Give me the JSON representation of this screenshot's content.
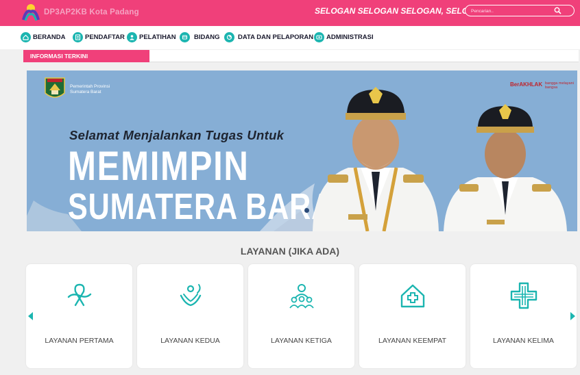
{
  "header": {
    "logo_text": "DP3AP2KB Kota Padang",
    "slogan": "SELOGAN SELOGAN SELOGAN, SELOGAN",
    "search_placeholder": "Pencarian..",
    "colors": {
      "primary": "#f0407a",
      "accent": "#1bb5b0"
    }
  },
  "nav": {
    "items": [
      {
        "label": "BERANDA",
        "icon": "home-icon"
      },
      {
        "label": "PENDAFTAR",
        "icon": "register-icon"
      },
      {
        "label": "PELATIHAN",
        "icon": "training-icon"
      },
      {
        "label": "BIDANG",
        "icon": "field-icon"
      },
      {
        "label": "DATA DAN PELAPORAN",
        "icon": "data-icon"
      },
      {
        "label": "ADMINISTRASI",
        "icon": "admin-icon"
      }
    ]
  },
  "info": {
    "label": "INFORMASI TERKINI"
  },
  "banner": {
    "org_line1": "Pemerintah Provinsi",
    "org_line2": "Sumatera Barat",
    "berakhlak": "BerAKHLAK",
    "bangga": "bangga melayani bangsa",
    "subtitle": "Selamat Menjalankan Tugas Untuk",
    "title_line1": "MEMIMPIN",
    "title_line2": "SUMATERA BARAT"
  },
  "services": {
    "title": "LAYANAN (JIKA ADA)",
    "items": [
      {
        "label": "LAYANAN PERTAMA",
        "icon": "ribbon-icon"
      },
      {
        "label": "LAYANAN KEDUA",
        "icon": "hands-icon"
      },
      {
        "label": "LAYANAN KETIGA",
        "icon": "family-icon"
      },
      {
        "label": "LAYANAN KEEMPAT",
        "icon": "health-house-icon"
      },
      {
        "label": "LAYANAN KELIMA",
        "icon": "medical-cross-icon"
      }
    ]
  }
}
